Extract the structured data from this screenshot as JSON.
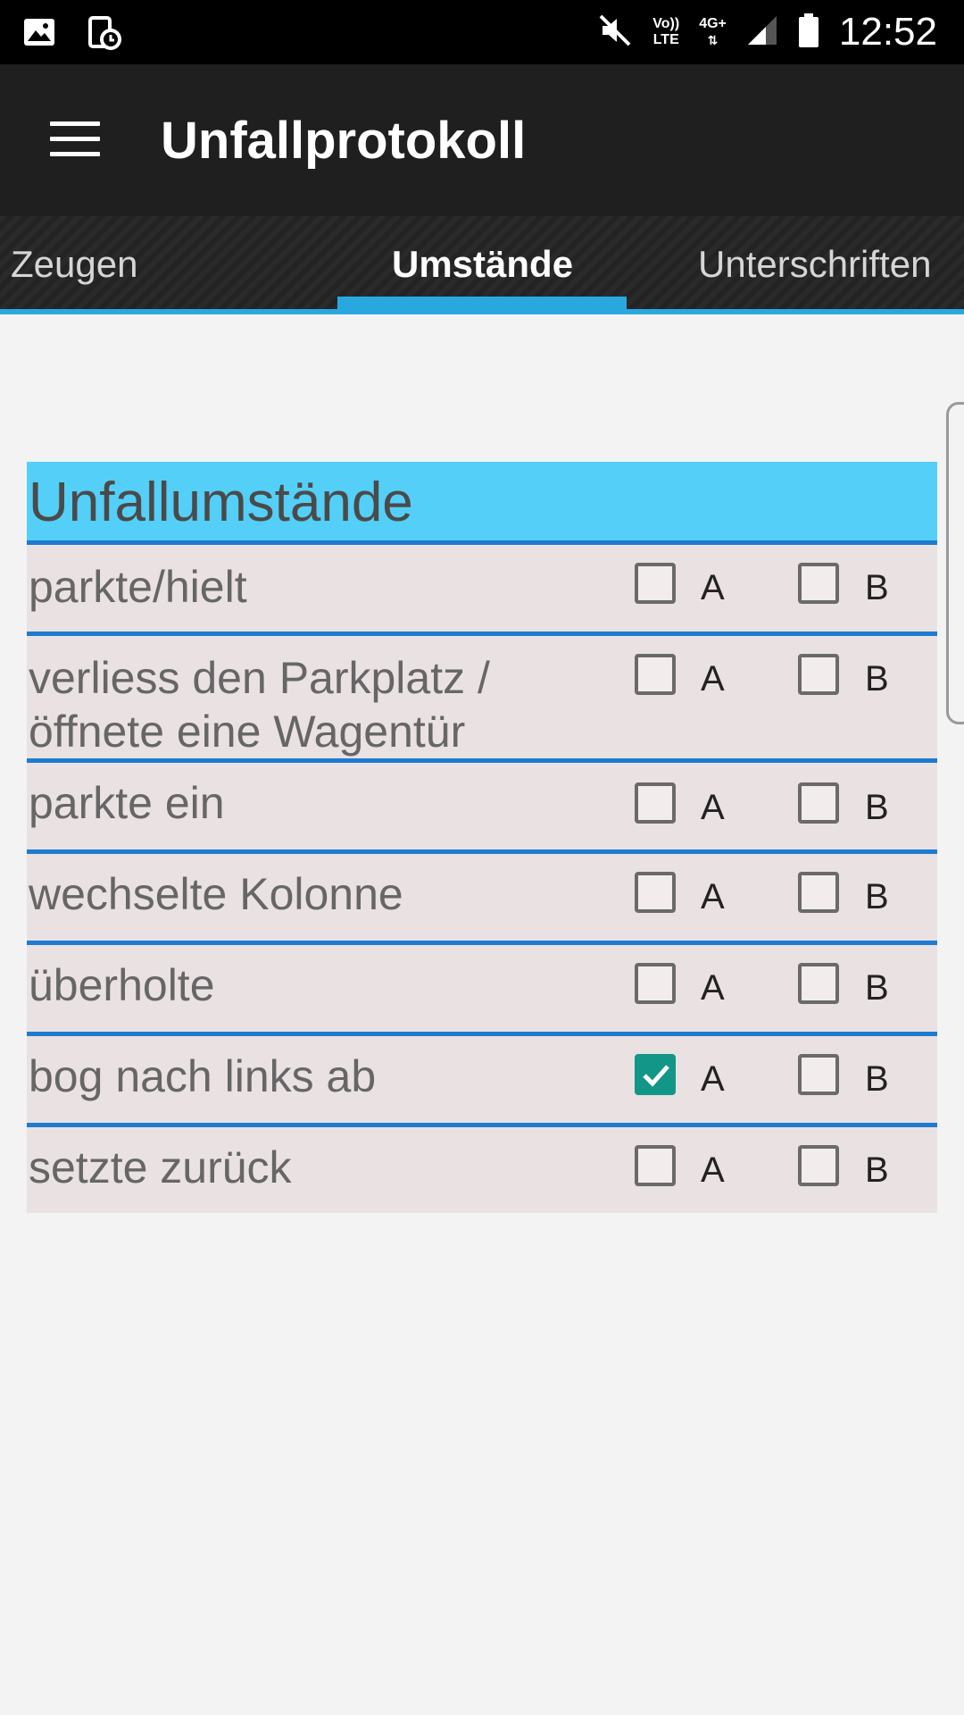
{
  "status_bar": {
    "time": "12:52",
    "volte_top": "Vo))",
    "volte_bottom": "LTE",
    "network": "4G+",
    "icons": [
      "gallery-icon",
      "screenshot-icon",
      "mute-icon",
      "volte-icon",
      "network-4g-icon",
      "signal-icon",
      "battery-icon"
    ]
  },
  "app_bar": {
    "title": "Unfallprotokoll",
    "menu_icon": "hamburger-menu-icon"
  },
  "tabs": [
    {
      "label": "Zeugen",
      "active": false
    },
    {
      "label": "Umstände",
      "active": true
    },
    {
      "label": "Unterschriften",
      "active": false
    }
  ],
  "section": {
    "title": "Unfallumstände",
    "option_a": "A",
    "option_b": "B",
    "rows": [
      {
        "label": "parkte/hielt",
        "a": false,
        "b": false
      },
      {
        "label_line1": "verliess den Parkplatz /",
        "label_line2": "öffnete eine Wagentür",
        "a": false,
        "b": false
      },
      {
        "label": "parkte ein",
        "a": false,
        "b": false
      },
      {
        "label": "wechselte Kolonne",
        "a": false,
        "b": false
      },
      {
        "label": "überholte",
        "a": false,
        "b": false
      },
      {
        "label": "bog nach links ab",
        "a": true,
        "b": false
      },
      {
        "label": "setzte zurück",
        "a": false,
        "b": false
      }
    ]
  },
  "colors": {
    "accent": "#29a8e0",
    "header_bg": "#54cff7",
    "divider": "#1e7bcf",
    "row_bg": "#eae1e2",
    "checked": "#129688"
  }
}
